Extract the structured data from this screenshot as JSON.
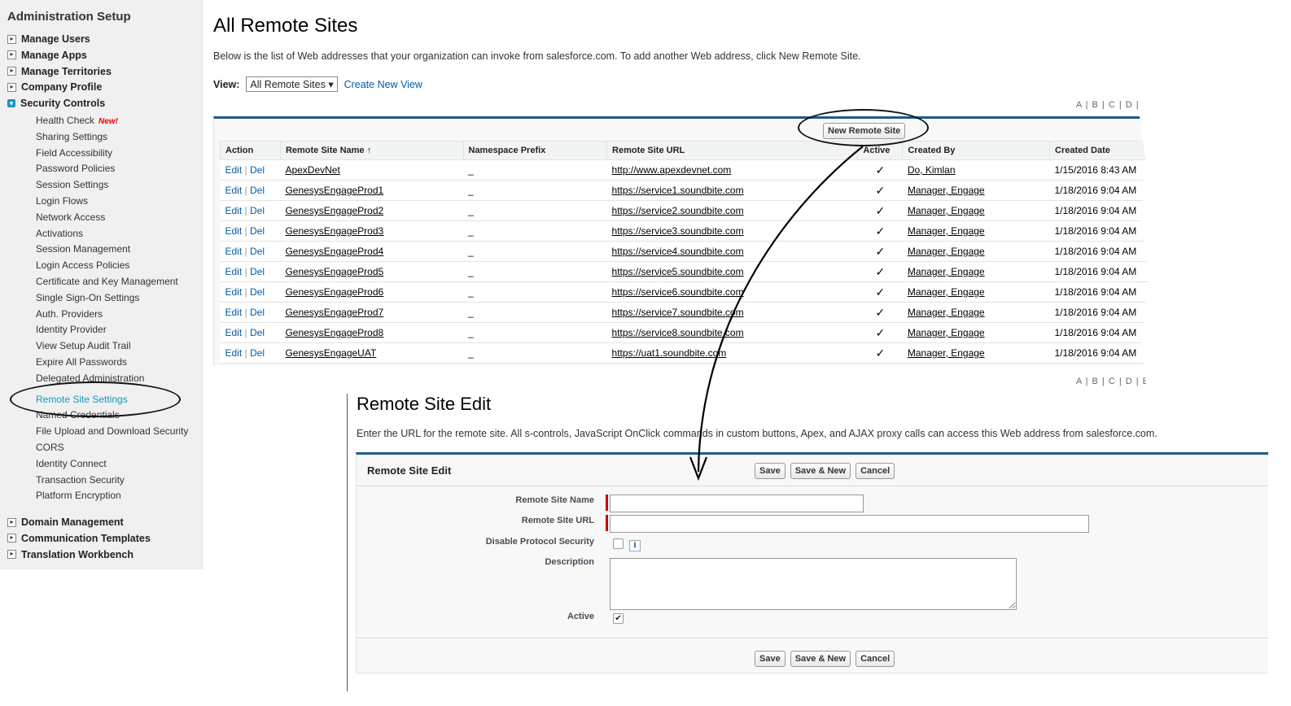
{
  "sidebar": {
    "title": "Administration Setup",
    "groups_top": [
      {
        "label": "Manage Users"
      },
      {
        "label": "Manage Apps"
      },
      {
        "label": "Manage Territories"
      },
      {
        "label": "Company Profile"
      },
      {
        "label": "Security Controls"
      }
    ],
    "security_items": [
      "Health Check",
      "Sharing Settings",
      "Field Accessibility",
      "Password Policies",
      "Session Settings",
      "Login Flows",
      "Network Access",
      "Activations",
      "Session Management",
      "Login Access Policies",
      "Certificate and Key Management",
      "Single Sign-On Settings",
      "Auth. Providers",
      "Identity Provider",
      "View Setup Audit Trail",
      "Expire All Passwords",
      "Delegated Administration",
      "Remote Site Settings",
      "Named Credentials",
      "File Upload and Download Security",
      "CORS",
      "Identity Connect",
      "Transaction Security",
      "Platform Encryption"
    ],
    "new_badge": "New!",
    "groups_bottom": [
      {
        "label": "Domain Management"
      },
      {
        "label": "Communication Templates"
      },
      {
        "label": "Translation Workbench"
      }
    ]
  },
  "main": {
    "title": "All Remote Sites",
    "intro": "Below is the list of Web addresses that your organization can invoke from salesforce.com. To add another Web address, click New Remote Site.",
    "view_label": "View:",
    "view_selected": "All Remote Sites",
    "create_view": "Create New View",
    "alpha_nav": "A | B | C | D | E",
    "new_remote_site": "New Remote Site",
    "columns": [
      "Action",
      "Remote Site Name ↑",
      "Namespace Prefix",
      "Remote Site URL",
      "Active",
      "Created By",
      "Created Date"
    ],
    "rows": [
      {
        "name": "ApexDevNet",
        "prefix": "_",
        "url": "http://www.apexdevnet.com",
        "active": "✓",
        "by": "Do, Kimlan",
        "date": "1/15/2016 8:43 AM"
      },
      {
        "name": "GenesysEngageProd1",
        "prefix": "_",
        "url": "https://service1.soundbite.com",
        "active": "✓",
        "by": "Manager, Engage",
        "date": "1/18/2016 9:04 AM"
      },
      {
        "name": "GenesysEngageProd2",
        "prefix": "_",
        "url": "https://service2.soundbite.com",
        "active": "✓",
        "by": "Manager, Engage",
        "date": "1/18/2016 9:04 AM"
      },
      {
        "name": "GenesysEngageProd3",
        "prefix": "_",
        "url": "https://service3.soundbite.com",
        "active": "✓",
        "by": "Manager, Engage",
        "date": "1/18/2016 9:04 AM"
      },
      {
        "name": "GenesysEngageProd4",
        "prefix": "_",
        "url": "https://service4.soundbite.com",
        "active": "✓",
        "by": "Manager, Engage",
        "date": "1/18/2016 9:04 AM"
      },
      {
        "name": "GenesysEngageProd5",
        "prefix": "_",
        "url": "https://service5.soundbite.com",
        "active": "✓",
        "by": "Manager, Engage",
        "date": "1/18/2016 9:04 AM"
      },
      {
        "name": "GenesysEngageProd6",
        "prefix": "_",
        "url": "https://service6.soundbite.com",
        "active": "✓",
        "by": "Manager, Engage",
        "date": "1/18/2016 9:04 AM"
      },
      {
        "name": "GenesysEngageProd7",
        "prefix": "_",
        "url": "https://service7.soundbite.com",
        "active": "✓",
        "by": "Manager, Engage",
        "date": "1/18/2016 9:04 AM"
      },
      {
        "name": "GenesysEngageProd8",
        "prefix": "_",
        "url": "https://service8.soundbite.com",
        "active": "✓",
        "by": "Manager, Engage",
        "date": "1/18/2016 9:04 AM"
      },
      {
        "name": "GenesysEngageUAT",
        "prefix": "_",
        "url": "https://uat1.soundbite.com",
        "active": "✓",
        "by": "Manager, Engage",
        "date": "1/18/2016 9:04 AM"
      }
    ],
    "edit_label": "Edit",
    "del_label": "Del"
  },
  "edit": {
    "title": "Remote Site Edit",
    "intro": "Enter the URL for the remote site. All s-controls, JavaScript OnClick commands in custom buttons, Apex, and AJAX proxy calls can access this Web address from salesforce.com.",
    "box_title": "Remote Site Edit",
    "save": "Save",
    "save_new": "Save & New",
    "cancel": "Cancel",
    "label_name": "Remote Site Name",
    "label_url": "Remote Site URL",
    "label_disable": "Disable Protocol Security",
    "label_desc": "Description",
    "label_active": "Active",
    "name_value": "",
    "url_value": "",
    "disable_checked": false,
    "active_checked": true,
    "info_icon": "i"
  }
}
